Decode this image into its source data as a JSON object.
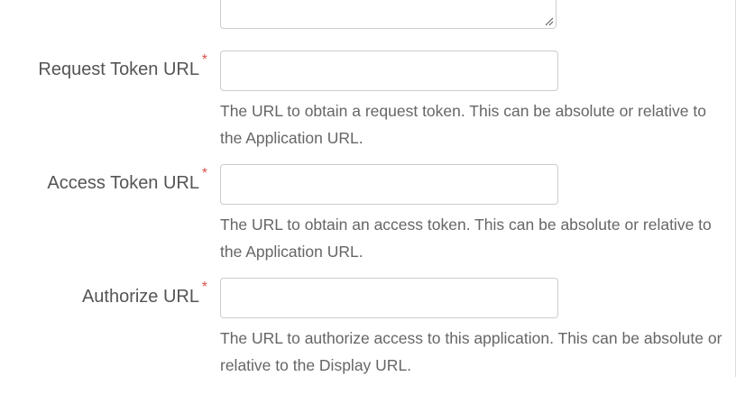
{
  "form": {
    "fields": [
      {
        "label": "Request Token URL",
        "required_mark": "*",
        "value": "",
        "placeholder": "",
        "help": "The URL to obtain a request token. This can be absolute or relative to the Application URL."
      },
      {
        "label": "Access Token URL",
        "required_mark": "*",
        "value": "",
        "placeholder": "",
        "help": "The URL to obtain an access token. This can be absolute or relative to the Application URL."
      },
      {
        "label": "Authorize URL",
        "required_mark": "*",
        "value": "",
        "placeholder": "",
        "help": "The URL to authorize access to this application. This can be absolute or relative to the Display URL."
      }
    ],
    "required_color": "#d9534f"
  }
}
